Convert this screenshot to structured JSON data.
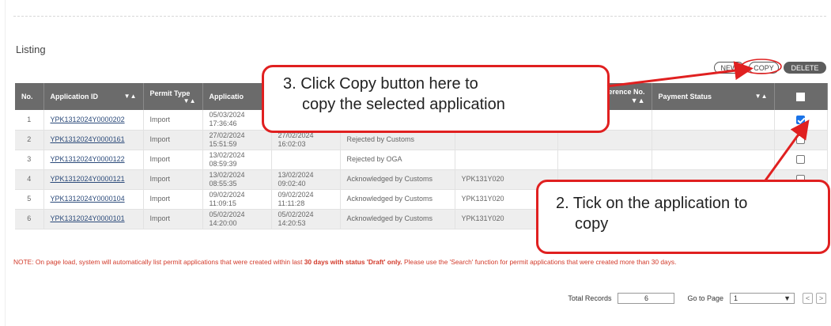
{
  "listing": {
    "title": "Listing"
  },
  "actions": {
    "new_label": "NEW",
    "copy_label": "COPY",
    "delete_label": "DELETE"
  },
  "table": {
    "columns": [
      {
        "label": "No."
      },
      {
        "label": "Application ID",
        "sort": "▼▲"
      },
      {
        "label": "Permit Type",
        "sort": "▼▲"
      },
      {
        "label": "Applicatio"
      },
      {
        "label": ""
      },
      {
        "label": ""
      },
      {
        "label": ""
      },
      {
        "label": "erence No.",
        "sort": "▼▲"
      },
      {
        "label": "Payment Status",
        "sort": "▼▲"
      },
      {
        "label": "select-all"
      }
    ],
    "rows": [
      {
        "no": "1",
        "id": "YPK1312024Y0000202",
        "type": "Import",
        "created": "05/03/2024 17:36:46",
        "submitted": "",
        "status": "",
        "permit_no": "",
        "ref": "",
        "payment": "",
        "checked": true
      },
      {
        "no": "2",
        "id": "YPK1312024Y0000161",
        "type": "Import",
        "created": "27/02/2024 15:51:59",
        "submitted": "27/02/2024 16:02:03",
        "status": "Rejected by Customs",
        "permit_no": "",
        "ref": "",
        "payment": "",
        "checked": false
      },
      {
        "no": "3",
        "id": "YPK1312024Y0000122",
        "type": "Import",
        "created": "13/02/2024 08:59:39",
        "submitted": "",
        "status": "Rejected by OGA",
        "permit_no": "",
        "ref": "",
        "payment": "",
        "checked": false
      },
      {
        "no": "4",
        "id": "YPK1312024Y0000121",
        "type": "Import",
        "created": "13/02/2024 08:55:35",
        "submitted": "13/02/2024 09:02:40",
        "status": "Acknowledged by Customs",
        "permit_no": "YPK131Y020",
        "ref": "",
        "payment": "",
        "checked": false
      },
      {
        "no": "5",
        "id": "YPK1312024Y0000104",
        "type": "Import",
        "created": "09/02/2024 11:09:15",
        "submitted": "09/02/2024 11:11:28",
        "status": "Acknowledged by Customs",
        "permit_no": "YPK131Y020",
        "ref": "",
        "payment": "",
        "checked": false
      },
      {
        "no": "6",
        "id": "YPK1312024Y0000101",
        "type": "Import",
        "created": "05/02/2024 14:20:00",
        "submitted": "05/02/2024 14:20:53",
        "status": "Acknowledged by Customs",
        "permit_no": "YPK131Y020",
        "ref": "",
        "payment": "",
        "checked": false
      }
    ]
  },
  "note": {
    "prefix": "NOTE: On page load, system will automatically list permit applications that were created within last ",
    "bold": "30 days with status 'Draft' only.",
    "suffix": " Please use the 'Search' function for permit applications that were created more than 30 days."
  },
  "footer": {
    "total_label": "Total Records",
    "total_value": "6",
    "goto_label": "Go to Page",
    "page_value": "1"
  },
  "callouts": {
    "copy": {
      "line1": "3.  Click Copy button here to",
      "line2": "copy the selected application"
    },
    "tick": {
      "line1": "2.  Tick on the application to",
      "line2": "copy"
    }
  },
  "colors": {
    "header_bg": "#6b6b6b",
    "annotation_red": "#e02020",
    "checkbox_blue": "#1a73e8",
    "note_red": "#d23a2a"
  }
}
